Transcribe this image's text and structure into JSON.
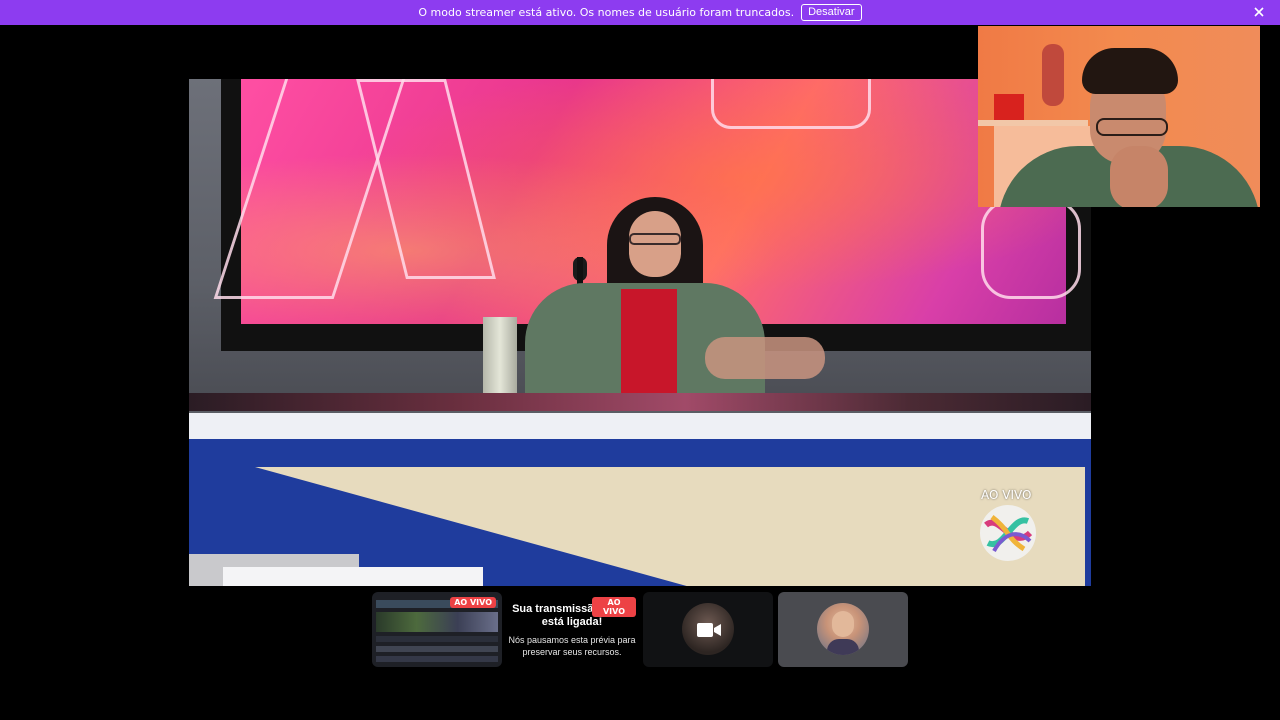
{
  "banner": {
    "message": "O modo streamer está ativo. Os nomes de usuário foram truncados.",
    "disable_label": "Desativar",
    "close_icon": "close-icon",
    "background_color": "#8d3cf0"
  },
  "main_stream": {
    "overlay_label": "AO VIVO",
    "logo_icon": "broadcaster-logo-icon"
  },
  "self_camera": {
    "icon": "webcam-feed"
  },
  "tiles": {
    "preview": {
      "badge": "AO VIVO"
    },
    "notice": {
      "badge": "AO VIVO",
      "title": "Sua transmissão ainda está ligada!",
      "description": "Nós pausamos esta prévia para preservar seus recursos."
    },
    "camera": {
      "icon": "camera-icon"
    },
    "user": {
      "icon": "avatar"
    }
  },
  "colors": {
    "live_badge": "#ed4245",
    "user_tile_bg": "#4a4b50"
  }
}
